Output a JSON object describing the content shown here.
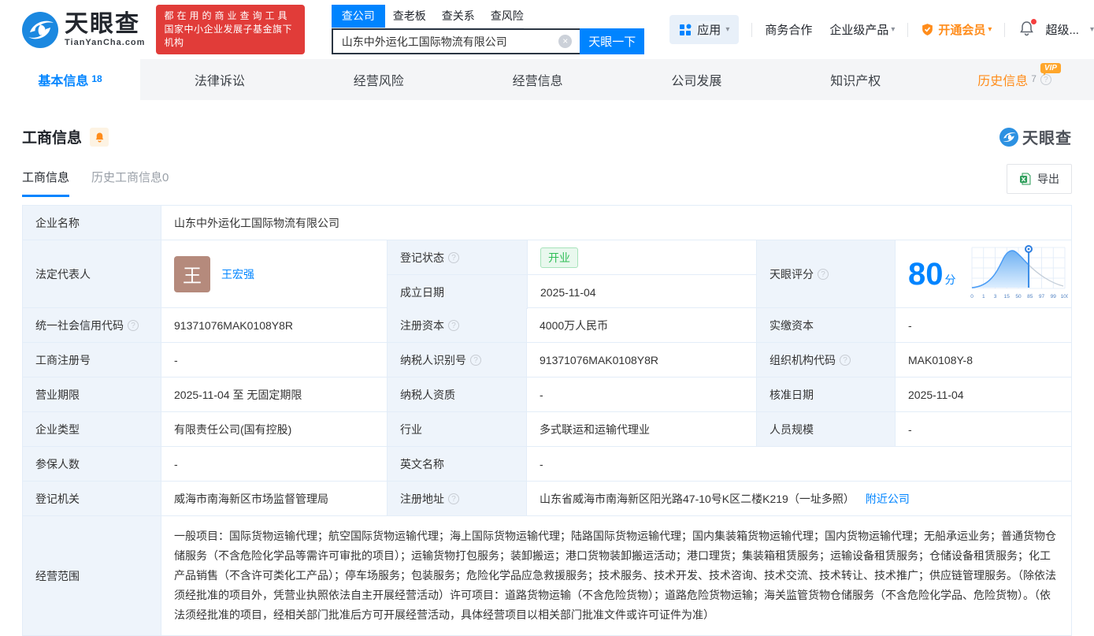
{
  "brand": {
    "logo_text": "天眼查",
    "logo_domain": "TianYanCha.com",
    "promo_line1": "都在用的商业查询工具",
    "promo_line2": "国家中小企业发展子基金旗下机构"
  },
  "search": {
    "tabs": [
      {
        "label": "查公司"
      },
      {
        "label": "查老板"
      },
      {
        "label": "查关系"
      },
      {
        "label": "查风险"
      }
    ],
    "value": "山东中外运化工国际物流有限公司",
    "button_label": "天眼一下"
  },
  "header_menu": {
    "apps_label": "应用",
    "coop_label": "商务合作",
    "enterprise_label": "企业级产品",
    "vip_label": "开通会员",
    "user_label": "超级..."
  },
  "icons": {
    "help": "?",
    "clear": "×",
    "caret_down": "▾",
    "vip_badge": "VIP"
  },
  "nav_tabs": [
    {
      "label": "基本信息",
      "count": "18"
    },
    {
      "label": "法律诉讼"
    },
    {
      "label": "经营风险"
    },
    {
      "label": "经营信息"
    },
    {
      "label": "公司发展"
    },
    {
      "label": "知识产权"
    },
    {
      "label": "历史信息",
      "count": "7"
    }
  ],
  "section": {
    "title": "工商信息",
    "watermark": "天眼查",
    "subtab_active": "工商信息",
    "subtab_history": "历史工商信息0",
    "export_label": "导出"
  },
  "table": {
    "company_name_label": "企业名称",
    "company_name": "山东中外运化工国际物流有限公司",
    "legal_rep_label": "法定代表人",
    "legal_rep_avatar": "王",
    "legal_rep_name": "王宏强",
    "reg_status_label": "登记状态",
    "reg_status": "开业",
    "establish_date_label": "成立日期",
    "establish_date": "2025-11-04",
    "score_label": "天眼评分",
    "score": "80",
    "score_unit": "分",
    "uscc_label": "统一社会信用代码",
    "uscc": "91371076MAK0108Y8R",
    "reg_capital_label": "注册资本",
    "reg_capital": "4000万人民币",
    "paid_capital_label": "实缴资本",
    "paid_capital": "-",
    "reg_number_label": "工商注册号",
    "reg_number": "-",
    "taxpayer_id_label": "纳税人识别号",
    "taxpayer_id": "91371076MAK0108Y8R",
    "org_code_label": "组织机构代码",
    "org_code": "MAK0108Y-8",
    "business_term_label": "营业期限",
    "business_term": "2025-11-04 至 无固定期限",
    "taxpayer_quality_label": "纳税人资质",
    "taxpayer_quality": "-",
    "approval_date_label": "核准日期",
    "approval_date": "2025-11-04",
    "company_type_label": "企业类型",
    "company_type": "有限责任公司(国有控股)",
    "industry_label": "行业",
    "industry": "多式联运和运输代理业",
    "staff_size_label": "人员规模",
    "staff_size": "-",
    "insured_count_label": "参保人数",
    "insured_count": "-",
    "english_name_label": "英文名称",
    "english_name": "-",
    "reg_authority_label": "登记机关",
    "reg_authority": "威海市南海新区市场监督管理局",
    "reg_address_label": "注册地址",
    "reg_address": "山东省威海市南海新区阳光路47-10号K区二楼K219（一址多照）",
    "nearby_link": "附近公司",
    "business_scope_label": "经营范围",
    "business_scope": "一般项目：国际货物运输代理；航空国际货物运输代理；海上国际货物运输代理；陆路国际货物运输代理；国内集装箱货物运输代理；国内货物运输代理；无船承运业务；普通货物仓储服务（不含危险化学品等需许可审批的项目）；运输货物打包服务；装卸搬运；港口货物装卸搬运活动；港口理货；集装箱租赁服务；运输设备租赁服务；仓储设备租赁服务；化工产品销售（不含许可类化工产品）；停车场服务；包装服务；危险化学品应急救援服务；技术服务、技术开发、技术咨询、技术交流、技术转让、技术推广；供应链管理服务。（除依法须经批准的项目外，凭营业执照依法自主开展经营活动）许可项目：道路货物运输（不含危险货物）；道路危险货物运输；海关监管货物仓储服务（不含危险化学品、危险货物）。（依法须经批准的项目，经相关部门批准后方可开展经营活动，具体经营项目以相关部门批准文件或许可证件为准）"
  },
  "colors": {
    "primary_blue": "#0084ff",
    "orange": "#ff8c1a",
    "promo_red": "#e13c39",
    "status_green": "#2fbe57",
    "label_bg": "#eef4fb"
  },
  "chart_data": {
    "type": "area",
    "title": "天眼评分",
    "score": 80,
    "score_unit": "分",
    "x_ticks": [
      "0",
      "1",
      "3",
      "15",
      "50",
      "85",
      "97",
      "99",
      "100"
    ],
    "marker_tick": "85",
    "grid": true,
    "note": "score distribution bell curve; blue filled area left of marker pin near the 85 tick, gray line to the right"
  }
}
